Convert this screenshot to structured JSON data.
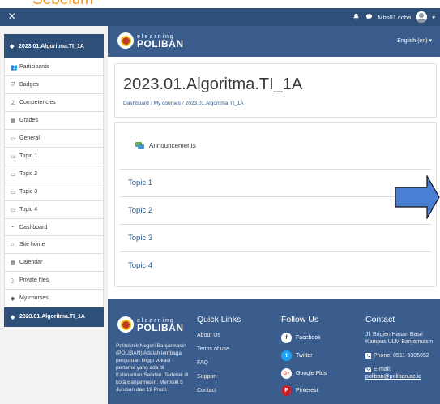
{
  "caption": "Sebelum",
  "topbar": {
    "close_icon": "×",
    "bell_icon": "🔔",
    "chat_icon": "💬",
    "username": "Mhs01 coba",
    "caret": "▾"
  },
  "sidebar": {
    "course_header": "2023.01.Algoritma.TI_1A",
    "course_items": [
      {
        "icon": "👥",
        "label": "Participants"
      },
      {
        "icon": "⛉",
        "label": "Badges"
      },
      {
        "icon": "☑",
        "label": "Competencies"
      },
      {
        "icon": "▦",
        "label": "Grades"
      },
      {
        "icon": "▭",
        "label": "General"
      },
      {
        "icon": "▭",
        "label": "Topic 1"
      },
      {
        "icon": "▭",
        "label": "Topic 2"
      },
      {
        "icon": "▭",
        "label": "Topic 3"
      },
      {
        "icon": "▭",
        "label": "Topic 4"
      }
    ],
    "nav_items": [
      {
        "icon": "◔",
        "label": "Dashboard"
      },
      {
        "icon": "⌂",
        "label": "Site home"
      },
      {
        "icon": "▦",
        "label": "Calendar"
      },
      {
        "icon": "▯",
        "label": "Private files"
      },
      {
        "icon": "◆",
        "label": "My courses"
      }
    ],
    "active_course": "2023.01.Algoritma.TI_1A",
    "cap_icon": "◆"
  },
  "banner": {
    "logo_top": "elearning",
    "logo_bottom": "POLIBAN",
    "language": "English (en) ▾"
  },
  "course": {
    "title": "2023.01.Algoritma.TI_1A",
    "breadcrumb": [
      "Dashboard",
      "My courses",
      "2023.01.Algoritma.TI_1A"
    ],
    "breadcrumb_sep": "/"
  },
  "content": {
    "announcements": "Announcements",
    "topics": [
      "Topic 1",
      "Topic 2",
      "Topic 3",
      "Topic 4"
    ]
  },
  "footer": {
    "logo_top": "elearning",
    "logo_bottom": "POLIBAN",
    "description": "Politeknik Negeri Banjarmasin (POLIBAN) Adalah lembaga perguruan tinggi vokasi pertama yang ada di Kalimantan Selatan. Terletak di kota Banjarmasin. Memiliki 5 Jurusan dan 19 Prodi.",
    "quick_links_title": "Quick Links",
    "quick_links": [
      "About Us",
      "Terms of use",
      "FAQ",
      "Support",
      "Contact"
    ],
    "follow_title": "Follow Us",
    "social": [
      {
        "letter": "f",
        "label": "Facebook",
        "color": "#3b5998"
      },
      {
        "letter": "t",
        "label": "Twitter",
        "color": "#1da1f2"
      },
      {
        "letter": "G+",
        "label": "Google Plus",
        "color": "#dd4b39"
      },
      {
        "letter": "P",
        "label": "Pinterest",
        "color": "#cb2027"
      }
    ],
    "contact_title": "Contact",
    "address": "Jl. Brigjen Hasan Basri Kampus ULM Banjarmasin",
    "phone": "Phone: 0511-3305052",
    "email_label": "E-mail:",
    "email": "poliban@poliban.ac.id"
  },
  "colors": {
    "navbar": "#2e4f78",
    "banner": "#3a5d8e",
    "link": "#2e5a8a",
    "arrow_fill": "#4a7fd4",
    "caption": "#f7941d"
  }
}
